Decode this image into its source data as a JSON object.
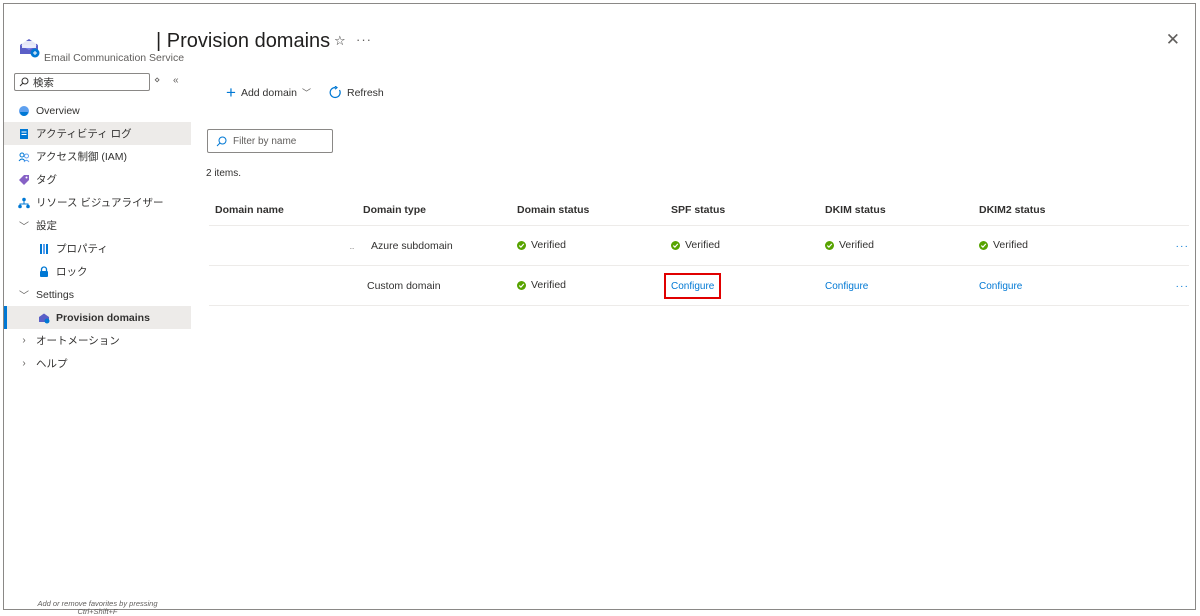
{
  "header": {
    "title": "| Provision domains",
    "service_name": "Email Communication Service",
    "star_glyph": "☆",
    "more_glyph": "···",
    "close_glyph": "✕"
  },
  "sidebar": {
    "search_placeholder": "検索",
    "tool_pin": "⋄",
    "tool_collapse": "«",
    "items": [
      {
        "label": "Overview",
        "icon": "overview-icon"
      },
      {
        "label": "アクティビティ ログ",
        "icon": "activity-log-icon"
      },
      {
        "label": "アクセス制御 (IAM)",
        "icon": "iam-icon"
      },
      {
        "label": "タグ",
        "icon": "tag-icon"
      },
      {
        "label": "リソース ビジュアライザー",
        "icon": "resource-visualizer-icon"
      },
      {
        "label": "設定",
        "expanded": true
      },
      {
        "label": "プロパティ",
        "icon": "properties-icon"
      },
      {
        "label": "ロック",
        "icon": "lock-icon"
      },
      {
        "label": "Settings",
        "expanded": true
      },
      {
        "label": "Provision domains",
        "icon": "provision-domains-icon",
        "selected": true
      },
      {
        "label": "オートメーション",
        "expanded": false
      },
      {
        "label": "ヘルプ",
        "expanded": false
      }
    ],
    "favorites_hint_line1": "Add or remove favorites by pressing",
    "favorites_hint_line2": "Ctrl+Shift+F"
  },
  "toolbar": {
    "add_domain": "Add domain",
    "refresh": "Refresh"
  },
  "filter": {
    "placeholder": "Filter by name"
  },
  "items_count": "2 items.",
  "grid": {
    "columns": [
      "Domain name",
      "Domain type",
      "Domain status",
      "SPF status",
      "DKIM status",
      "DKIM2 status"
    ],
    "rows": [
      {
        "name": "",
        "type": "Azure subdomain",
        "domain_status": "Verified",
        "spf": "Verified",
        "dkim": "Verified",
        "dkim2": "Verified",
        "more": "···"
      },
      {
        "name": "",
        "type": "Custom domain",
        "domain_status": "Verified",
        "spf": "Configure",
        "dkim": "Configure",
        "dkim2": "Configure",
        "more": "···"
      }
    ],
    "expand_glyph": "..",
    "highlight_color": "#e00000"
  },
  "colors": {
    "accent": "#0078d4",
    "verified": "#57a300",
    "selected_bg": "#edebe9"
  }
}
